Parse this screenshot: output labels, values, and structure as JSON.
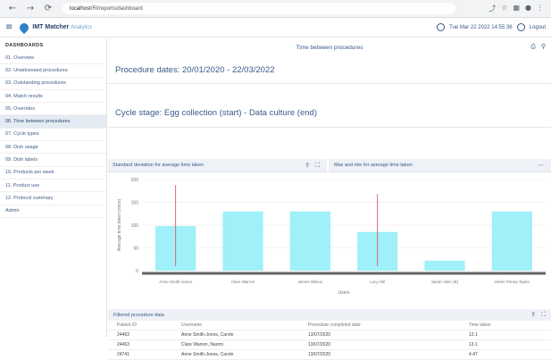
{
  "browser": {
    "url_host": "localhost",
    "url_path": "/RI/reports/dashboard"
  },
  "header": {
    "brand": "IMT Matcher",
    "brand_sub": "Analytics",
    "datetime": "Tue Mar 22 2022 14:55:36",
    "logout": "Logout"
  },
  "sidebar": {
    "title": "DASHBOARDS",
    "items": [
      {
        "label": "01. Overview"
      },
      {
        "label": "02. Unwitnessed procedures"
      },
      {
        "label": "03. Outstanding procedures"
      },
      {
        "label": "04. Match results"
      },
      {
        "label": "05. Overrides"
      },
      {
        "label": "06. Time between procedures",
        "active": true
      },
      {
        "label": "07. Cycle types"
      },
      {
        "label": "08. Dish usage"
      },
      {
        "label": "09. Dish labels"
      },
      {
        "label": "10. Products per week"
      },
      {
        "label": "11. Product use"
      },
      {
        "label": "12. Protocol summary"
      },
      {
        "label": "Admin"
      }
    ]
  },
  "page": {
    "title": "Time between procedures",
    "procedure_dates": "Procedure dates: 20/01/2020 - 22/03/2022",
    "cycle_stage": "Cycle stage: Egg collection (start) - Data culture (end)"
  },
  "panels": {
    "left_title": "Standard deviation for average time taken",
    "right_title": "Max and min for average time taken"
  },
  "chart_data": {
    "type": "bar",
    "title": "",
    "xlabel": "Users",
    "ylabel": "Average time taken (mins)",
    "ylim": [
      0,
      200
    ],
    "yticks": [
      "0",
      "50",
      "100",
      "150",
      "200"
    ],
    "categories": [
      "Anne Smith-Jones",
      "Clare Warren",
      "James Wilson",
      "Lucy Hill",
      "Sarah Allen (B)",
      "Helen Penny-Taylor"
    ],
    "values": [
      98,
      130,
      130,
      85,
      22,
      130
    ],
    "error_low": [
      10,
      null,
      null,
      10,
      null,
      null
    ],
    "error_high": [
      188,
      null,
      null,
      168,
      null,
      null
    ],
    "bar_color": "#9ff0f8",
    "error_color": "#e0565a",
    "grid": true
  },
  "table": {
    "title": "Filtered procedure data",
    "columns": [
      "Patient ID",
      "Username",
      "Procedure completed date",
      "Time taken"
    ],
    "rows": [
      [
        "24463",
        "Anne Smith-Jones, Carole",
        "13/07/2020",
        "13.1"
      ],
      [
        "24463",
        "Clare Warren, Naomi",
        "13/07/2020",
        "13.1"
      ],
      [
        "24741",
        "Anne Smith-Jones, Carole",
        "13/07/2020",
        "4.47"
      ]
    ]
  },
  "icons": {
    "back": "back-arrow-icon",
    "forward": "forward-arrow-icon",
    "reload": "reload-icon",
    "menu": "hamburger-icon",
    "export": "export-icon",
    "fullscreen": "fullscreen-icon"
  }
}
